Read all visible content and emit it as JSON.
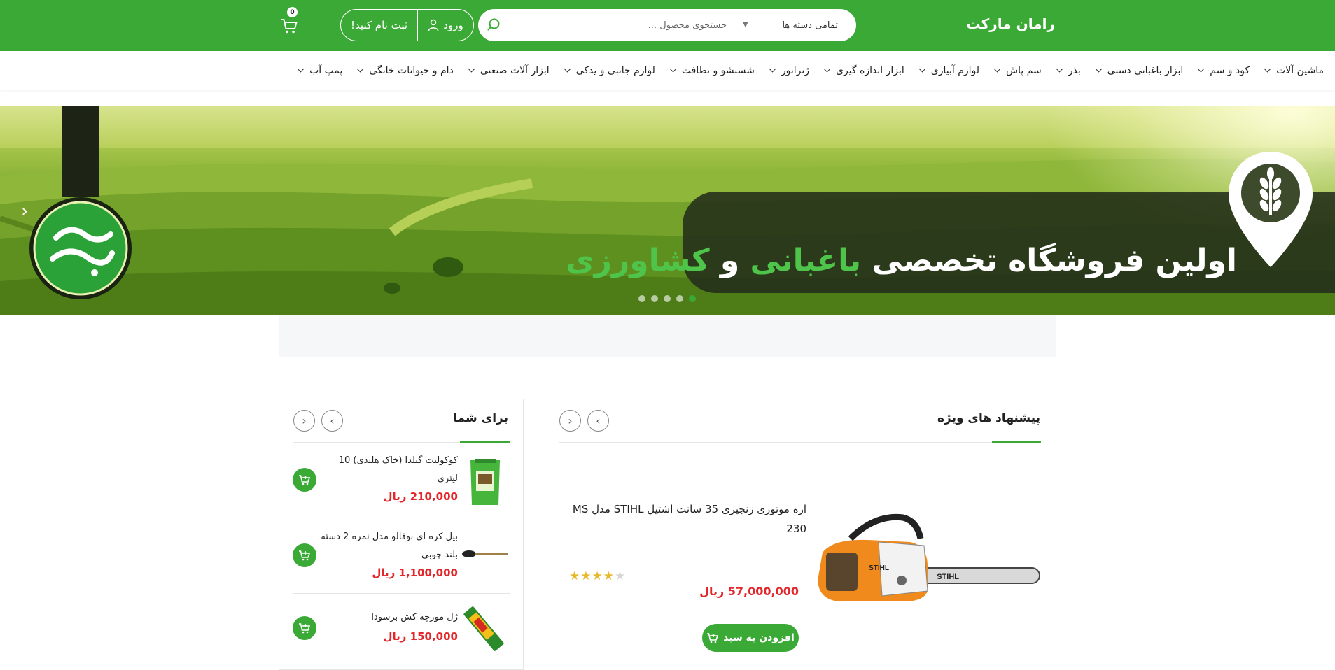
{
  "header": {
    "brand": "رامان مارکت",
    "search": {
      "category": "تمامی دسته ها",
      "placeholder": "جستجوی محصول ..."
    },
    "auth": {
      "login": "ورود",
      "register": "ثبت نام کنید!"
    },
    "cart_count": "0",
    "bg_color": "#3aa935"
  },
  "nav": {
    "items": [
      "ماشین آلات",
      "کود و سم",
      "ابزار باغبانی دستی",
      "بذر",
      "سم پاش",
      "لوازم آبیاری",
      "ابزار اندازه گیری",
      "ژنراتور",
      "شستشو و نظافت",
      "لوازم جانبی و یدکی",
      "ابزار آلات صنعتی",
      "دام و حیوانات خانگی",
      "پمپ آب"
    ]
  },
  "slider": {
    "headline_part1": "اولین فروشگاه تخصصی",
    "headline_green1": "باغبانی",
    "headline_and": "و",
    "headline_green2": "کشاورزی",
    "slides": 5,
    "active_slide": 5
  },
  "special": {
    "title": "پیشنهاد های ویژه",
    "product": {
      "name": "اره موتوری زنجیری 35 سانت اشتیل STIHL مدل MS 230",
      "price": "57,000,000 ریال",
      "rating": 3.5,
      "rating_max": 5,
      "add_to_cart": "افزودن به سبد"
    }
  },
  "foryou": {
    "title": "برای شما",
    "items": [
      {
        "name": "کوکولیت گیلدا (خاک هلندی) 10 لیتری",
        "price": "210,000 ریال"
      },
      {
        "name": "بیل کره ای بوفالو مدل نمره 2 دسته بلند چوبی",
        "price": "1,100,000 ریال"
      },
      {
        "name": "ژل مورچه کش برسودا",
        "price": "150,000 ریال"
      }
    ]
  },
  "colors": {
    "accent": "#3aa935",
    "price": "#e3262a"
  }
}
